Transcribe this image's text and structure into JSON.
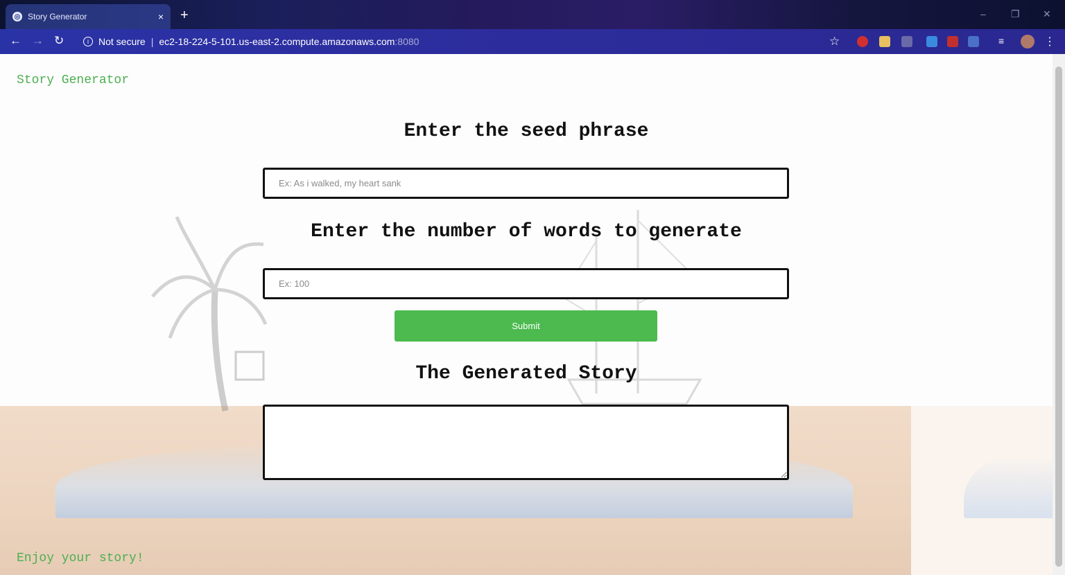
{
  "browser": {
    "tab_title": "Story Generator",
    "tab_close": "×",
    "new_tab": "+",
    "security_label": "Not secure",
    "url_host": "ec2-18-224-5-101.us-east-2.compute.amazonaws.com",
    "url_port": ":8080"
  },
  "header": {
    "brand": "Story Generator"
  },
  "form": {
    "seed_heading": "Enter the seed phrase",
    "seed_placeholder": "Ex: As i walked, my heart sank",
    "count_heading": "Enter the number of words to generate",
    "count_placeholder": "Ex: 100",
    "submit_label": "Submit"
  },
  "output": {
    "heading": "The Generated Story",
    "story_text": ""
  },
  "footer": {
    "text": "Enjoy your story!"
  },
  "colors": {
    "accent_green": "#4caf50",
    "button_green": "#4cba4f"
  }
}
